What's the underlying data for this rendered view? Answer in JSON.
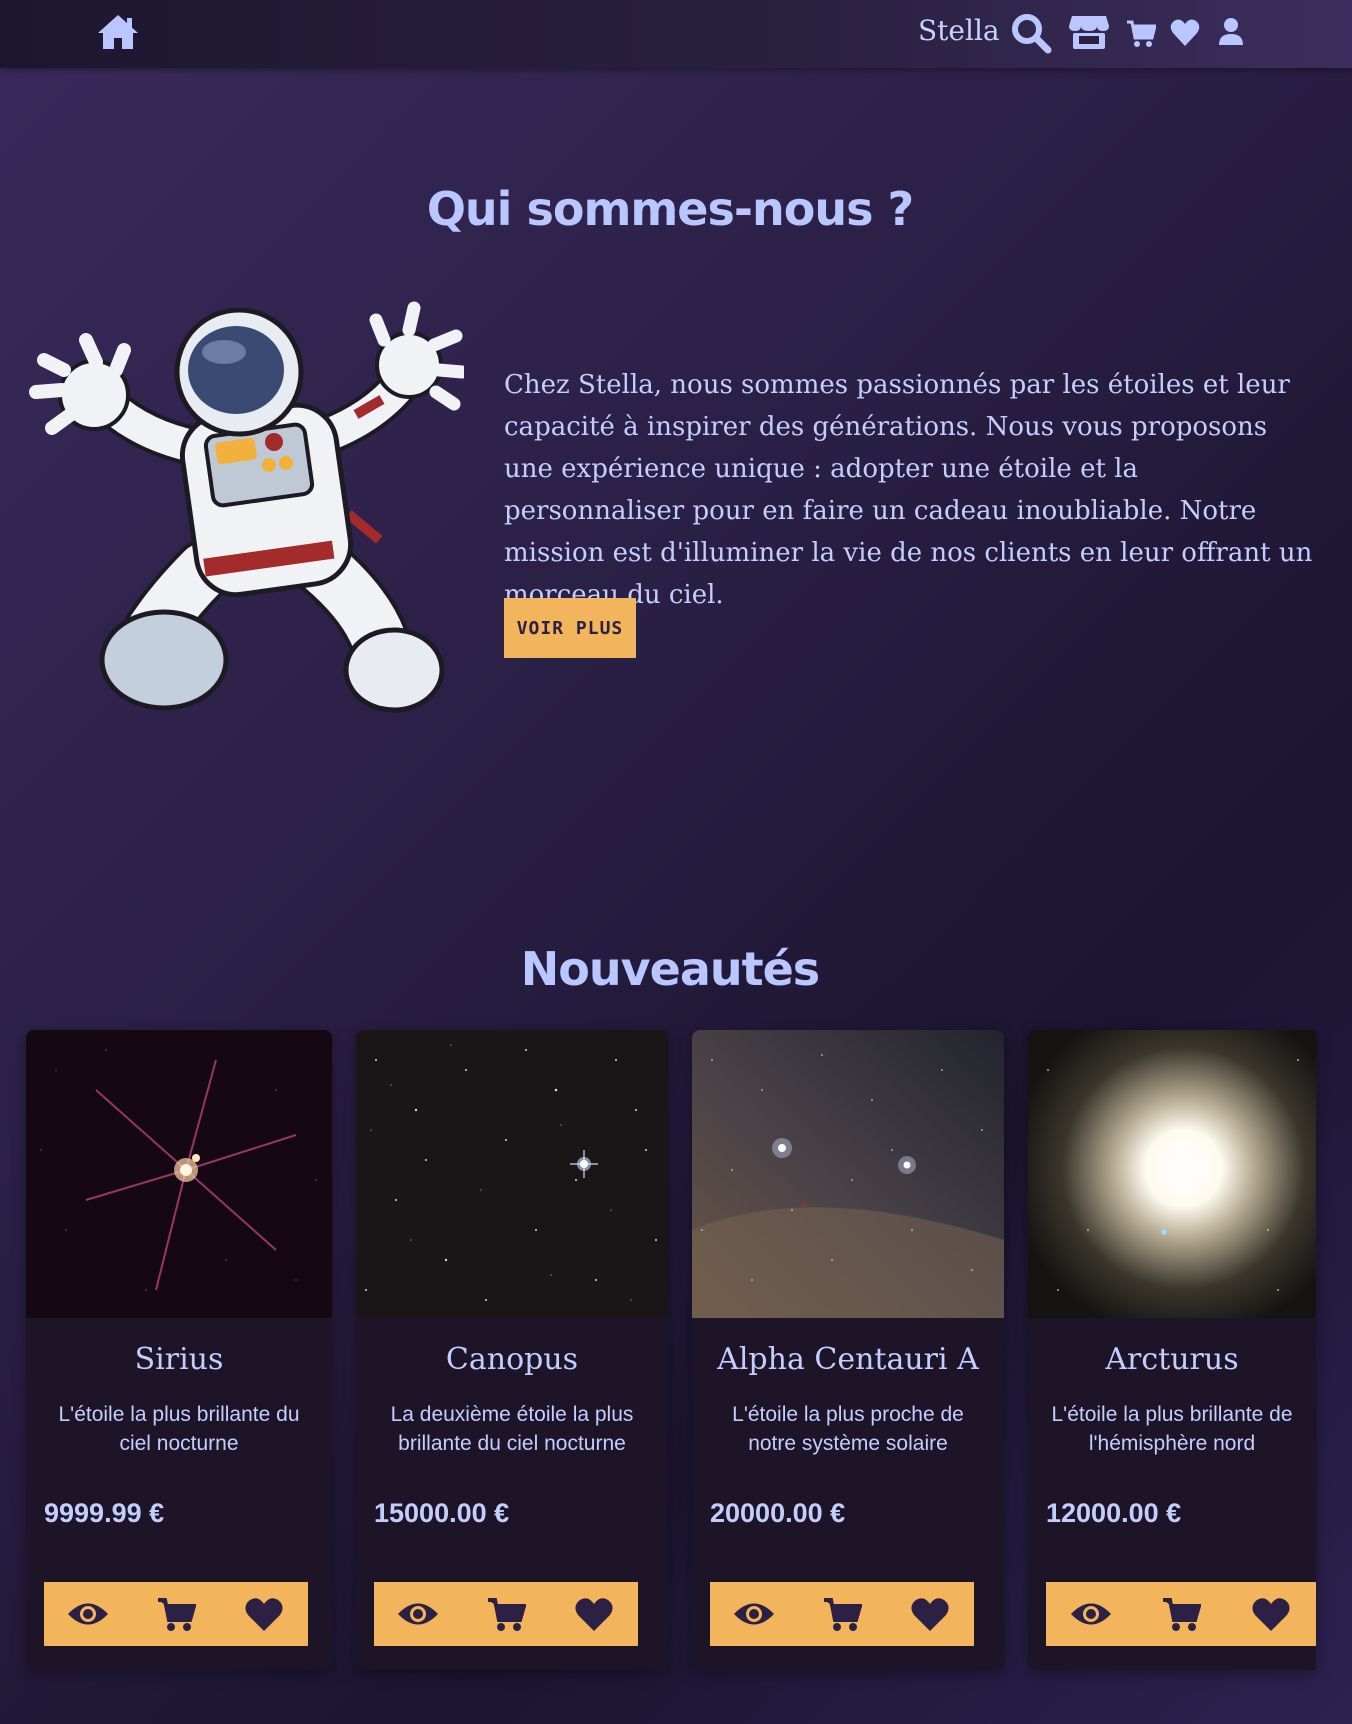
{
  "header": {
    "brand": "Stella",
    "icons": [
      "home-icon",
      "search-icon",
      "store-icon",
      "cart-icon",
      "heart-icon",
      "user-icon"
    ]
  },
  "about": {
    "title": "Qui sommes-nous ?",
    "text": "Chez Stella, nous sommes passionnés par les étoiles et leur capacité à inspirer des générations. Nous vous proposons une expérience unique : adopter une étoile et la personnaliser pour en faire un cadeau inoubliable. Notre mission est d'illuminer la vie de nos clients en leur offrant un morceau du ciel.",
    "button_label": "VOIR PLUS"
  },
  "new_products": {
    "title": "Nouveautés",
    "items": [
      {
        "name": "Sirius",
        "description": "L'étoile la plus brillante du ciel nocturne",
        "price": "9999.99 €"
      },
      {
        "name": "Canopus",
        "description": "La deuxième étoile la plus brillante du ciel nocturne",
        "price": "15000.00 €"
      },
      {
        "name": "Alpha Centauri A",
        "description": "L'étoile la plus proche de notre système solaire",
        "price": "20000.00 €"
      },
      {
        "name": "Arcturus",
        "description": "L'étoile la plus brillante de l'hémisphère nord",
        "price": "12000.00 €"
      }
    ],
    "action_icons": [
      "eye-icon",
      "cart-icon",
      "heart-icon"
    ]
  },
  "colors": {
    "accent": "#f2b55c",
    "text": "#c3ceff",
    "card_bg": "#1d1428",
    "header_bg": "#2a2040"
  }
}
